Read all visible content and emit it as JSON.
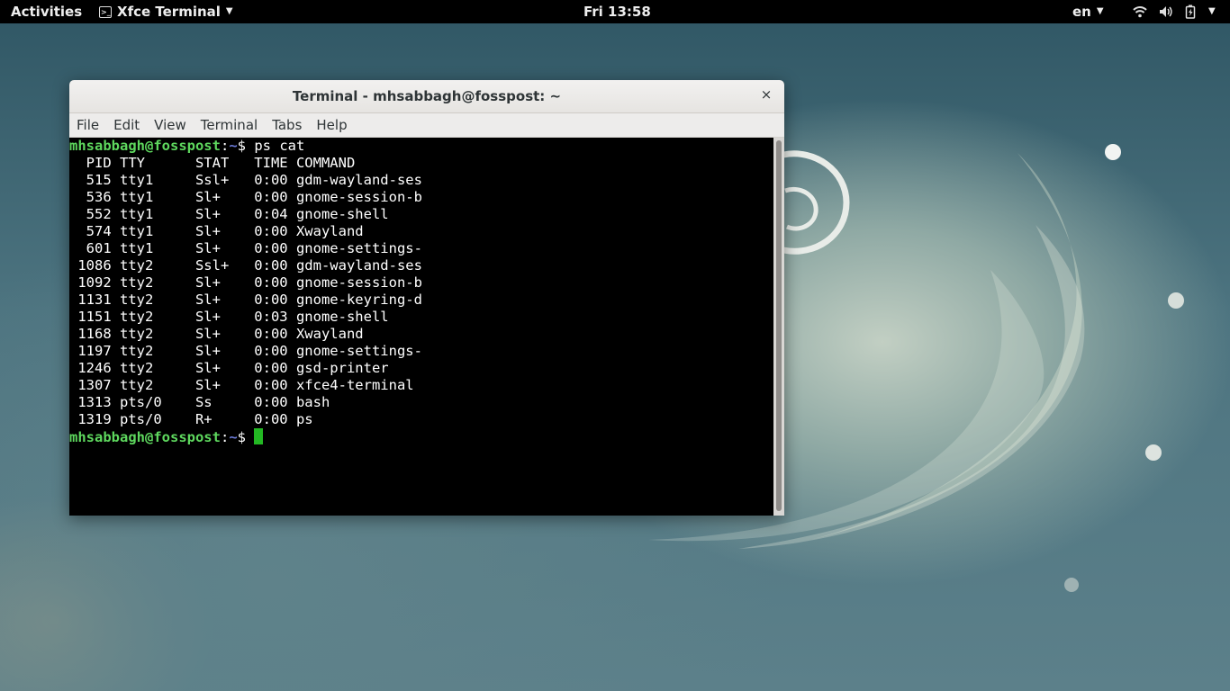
{
  "topbar": {
    "activities": "Activities",
    "app_name": "Xfce Terminal",
    "clock": "Fri 13:58",
    "lang": "en"
  },
  "window": {
    "title": "Terminal - mhsabbagh@fosspost: ~",
    "close_glyph": "×",
    "menu": [
      "File",
      "Edit",
      "View",
      "Terminal",
      "Tabs",
      "Help"
    ]
  },
  "terminal": {
    "user_host": "mhsabbagh@fosspost",
    "colon": ":",
    "path": "~",
    "prompt_symbol": "$",
    "command": " ps cat",
    "output": [
      "  PID TTY      STAT   TIME COMMAND",
      "  515 tty1     Ssl+   0:00 gdm-wayland-ses",
      "  536 tty1     Sl+    0:00 gnome-session-b",
      "  552 tty1     Sl+    0:04 gnome-shell",
      "  574 tty1     Sl+    0:00 Xwayland",
      "  601 tty1     Sl+    0:00 gnome-settings-",
      " 1086 tty2     Ssl+   0:00 gdm-wayland-ses",
      " 1092 tty2     Sl+    0:00 gnome-session-b",
      " 1131 tty2     Sl+    0:00 gnome-keyring-d",
      " 1151 tty2     Sl+    0:03 gnome-shell",
      " 1168 tty2     Sl+    0:00 Xwayland",
      " 1197 tty2     Sl+    0:00 gnome-settings-",
      " 1246 tty2     Sl+    0:00 gsd-printer",
      " 1307 tty2     Sl+    0:00 xfce4-terminal",
      " 1313 pts/0    Ss     0:00 bash",
      " 1319 pts/0    R+     0:00 ps"
    ]
  },
  "icons": {
    "app": "terminal-icon",
    "wifi": "wifi-icon",
    "volume": "volume-icon",
    "battery": "battery-icon",
    "menu": "chevron-down-icon"
  }
}
